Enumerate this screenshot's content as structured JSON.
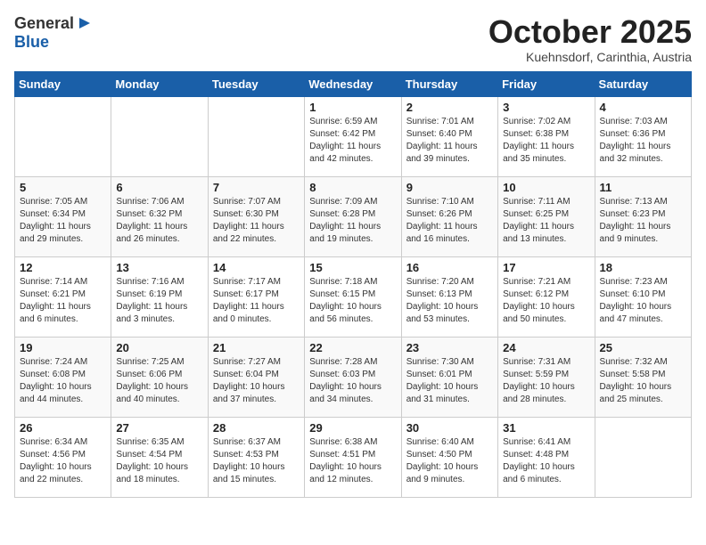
{
  "header": {
    "logo_line1": "General",
    "logo_line2": "Blue",
    "month": "October 2025",
    "location": "Kuehnsdorf, Carinthia, Austria"
  },
  "days_of_week": [
    "Sunday",
    "Monday",
    "Tuesday",
    "Wednesday",
    "Thursday",
    "Friday",
    "Saturday"
  ],
  "weeks": [
    [
      {
        "day": "",
        "info": ""
      },
      {
        "day": "",
        "info": ""
      },
      {
        "day": "",
        "info": ""
      },
      {
        "day": "1",
        "info": "Sunrise: 6:59 AM\nSunset: 6:42 PM\nDaylight: 11 hours\nand 42 minutes."
      },
      {
        "day": "2",
        "info": "Sunrise: 7:01 AM\nSunset: 6:40 PM\nDaylight: 11 hours\nand 39 minutes."
      },
      {
        "day": "3",
        "info": "Sunrise: 7:02 AM\nSunset: 6:38 PM\nDaylight: 11 hours\nand 35 minutes."
      },
      {
        "day": "4",
        "info": "Sunrise: 7:03 AM\nSunset: 6:36 PM\nDaylight: 11 hours\nand 32 minutes."
      }
    ],
    [
      {
        "day": "5",
        "info": "Sunrise: 7:05 AM\nSunset: 6:34 PM\nDaylight: 11 hours\nand 29 minutes."
      },
      {
        "day": "6",
        "info": "Sunrise: 7:06 AM\nSunset: 6:32 PM\nDaylight: 11 hours\nand 26 minutes."
      },
      {
        "day": "7",
        "info": "Sunrise: 7:07 AM\nSunset: 6:30 PM\nDaylight: 11 hours\nand 22 minutes."
      },
      {
        "day": "8",
        "info": "Sunrise: 7:09 AM\nSunset: 6:28 PM\nDaylight: 11 hours\nand 19 minutes."
      },
      {
        "day": "9",
        "info": "Sunrise: 7:10 AM\nSunset: 6:26 PM\nDaylight: 11 hours\nand 16 minutes."
      },
      {
        "day": "10",
        "info": "Sunrise: 7:11 AM\nSunset: 6:25 PM\nDaylight: 11 hours\nand 13 minutes."
      },
      {
        "day": "11",
        "info": "Sunrise: 7:13 AM\nSunset: 6:23 PM\nDaylight: 11 hours\nand 9 minutes."
      }
    ],
    [
      {
        "day": "12",
        "info": "Sunrise: 7:14 AM\nSunset: 6:21 PM\nDaylight: 11 hours\nand 6 minutes."
      },
      {
        "day": "13",
        "info": "Sunrise: 7:16 AM\nSunset: 6:19 PM\nDaylight: 11 hours\nand 3 minutes."
      },
      {
        "day": "14",
        "info": "Sunrise: 7:17 AM\nSunset: 6:17 PM\nDaylight: 11 hours\nand 0 minutes."
      },
      {
        "day": "15",
        "info": "Sunrise: 7:18 AM\nSunset: 6:15 PM\nDaylight: 10 hours\nand 56 minutes."
      },
      {
        "day": "16",
        "info": "Sunrise: 7:20 AM\nSunset: 6:13 PM\nDaylight: 10 hours\nand 53 minutes."
      },
      {
        "day": "17",
        "info": "Sunrise: 7:21 AM\nSunset: 6:12 PM\nDaylight: 10 hours\nand 50 minutes."
      },
      {
        "day": "18",
        "info": "Sunrise: 7:23 AM\nSunset: 6:10 PM\nDaylight: 10 hours\nand 47 minutes."
      }
    ],
    [
      {
        "day": "19",
        "info": "Sunrise: 7:24 AM\nSunset: 6:08 PM\nDaylight: 10 hours\nand 44 minutes."
      },
      {
        "day": "20",
        "info": "Sunrise: 7:25 AM\nSunset: 6:06 PM\nDaylight: 10 hours\nand 40 minutes."
      },
      {
        "day": "21",
        "info": "Sunrise: 7:27 AM\nSunset: 6:04 PM\nDaylight: 10 hours\nand 37 minutes."
      },
      {
        "day": "22",
        "info": "Sunrise: 7:28 AM\nSunset: 6:03 PM\nDaylight: 10 hours\nand 34 minutes."
      },
      {
        "day": "23",
        "info": "Sunrise: 7:30 AM\nSunset: 6:01 PM\nDaylight: 10 hours\nand 31 minutes."
      },
      {
        "day": "24",
        "info": "Sunrise: 7:31 AM\nSunset: 5:59 PM\nDaylight: 10 hours\nand 28 minutes."
      },
      {
        "day": "25",
        "info": "Sunrise: 7:32 AM\nSunset: 5:58 PM\nDaylight: 10 hours\nand 25 minutes."
      }
    ],
    [
      {
        "day": "26",
        "info": "Sunrise: 6:34 AM\nSunset: 4:56 PM\nDaylight: 10 hours\nand 22 minutes."
      },
      {
        "day": "27",
        "info": "Sunrise: 6:35 AM\nSunset: 4:54 PM\nDaylight: 10 hours\nand 18 minutes."
      },
      {
        "day": "28",
        "info": "Sunrise: 6:37 AM\nSunset: 4:53 PM\nDaylight: 10 hours\nand 15 minutes."
      },
      {
        "day": "29",
        "info": "Sunrise: 6:38 AM\nSunset: 4:51 PM\nDaylight: 10 hours\nand 12 minutes."
      },
      {
        "day": "30",
        "info": "Sunrise: 6:40 AM\nSunset: 4:50 PM\nDaylight: 10 hours\nand 9 minutes."
      },
      {
        "day": "31",
        "info": "Sunrise: 6:41 AM\nSunset: 4:48 PM\nDaylight: 10 hours\nand 6 minutes."
      },
      {
        "day": "",
        "info": ""
      }
    ]
  ]
}
